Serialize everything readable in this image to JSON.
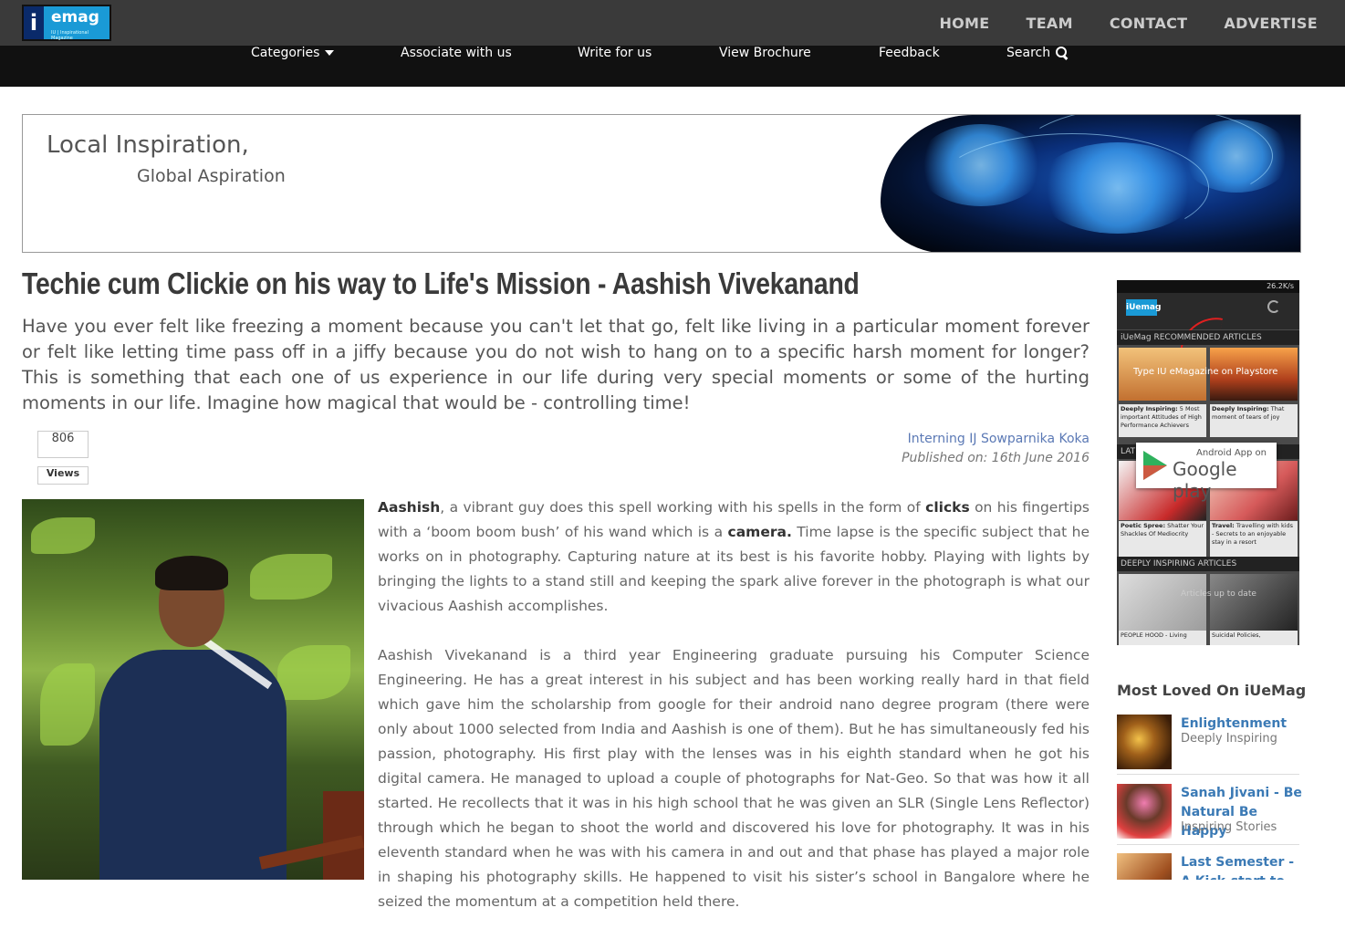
{
  "logo": {
    "letter": "i",
    "text": "emag",
    "subtext": "IU | Inspirational Magazine"
  },
  "topnav": [
    "HOME",
    "TEAM",
    "CONTACT",
    "ADVERTISE"
  ],
  "subnav": {
    "categories": "Categories",
    "associate": "Associate with us",
    "write": "Write for us",
    "brochure": "View Brochure",
    "feedback": "Feedback",
    "search": "Search"
  },
  "banner": {
    "line1": "Local Inspiration,",
    "line2": "Global Aspiration"
  },
  "article": {
    "title": "Techie cum Clickie on his way to Life's Mission - Aashish Vivekanand",
    "intro": "Have you ever felt like freezing a moment because you can't let that go, felt like living in a particular moment forever or felt like letting time pass off in a jiffy because you do not wish to hang on to a specific harsh moment for longer? This is something that each one of us experience in our life during very special moments or some of the hurting moments in our life. Imagine how magical that would be - controlling time!",
    "views_count": "806",
    "views_label": "Views",
    "author": "Interning IJ Sowparnika Koka",
    "published": "Published on: 16th June 2016",
    "p1_b1": "Aashish",
    "p1_t1": ", a vibrant guy does this spell working with his spells in the form of ",
    "p1_b2": "clicks",
    "p1_t2": " on his fingertips with a ‘boom boom bush’ of his wand which is a ",
    "p1_b3": "camera.",
    "p1_t3": " Time lapse is the specific subject that he works on in photography. Capturing nature at its best is his favorite hobby. Playing with lights by bringing the lights to a stand still and keeping the spark alive forever in the photograph is what our vivacious Aashish accomplishes.",
    "p2": "Aashish Vivekanand is a third year Engineering graduate pursuing his Computer Science Engineering. He has a great interest in his subject and has been working really hard in that field which gave him the scholarship from google for their android nano degree program (there were only about 1000 selected from India and Aashish is one of them). But he has simultaneously fed his passion, photography. His first play with the lenses was in his eighth standard when he got his digital camera. He managed to upload a couple of photographs for Nat-Geo. So that was how it all started. He recollects that it was in his high school that he was given an SLR (Single Lens Reflector) through which he began to shoot the world and discovered his love for photography. It was in his eleventh standard when he was with his camera in and out and that phase has played a major role in shaping his photography skills. He happened to visit his sister’s school in Bangalore where he seized the momentum at a competition held there."
  },
  "app_promo": {
    "status": "26.2K/s",
    "app_logo": "iUemag",
    "section1": "iUeMag RECOMMENDED ARTICLES",
    "tip": "Type IU eMagazine on Playstore",
    "cap1_b": "Deeply Inspiring:",
    "cap1": " 5 Most important Attitudes of High Performance Achievers",
    "cap2_b": "Deeply Inspiring:",
    "cap2": " That moment of tears of joy",
    "section2": "LAT",
    "gplay_small": "Android App on",
    "gplay_big": "Google play",
    "cap3_b": "Poetic Spree:",
    "cap3": " Shatter Your Shackles Of Mediocrity",
    "cap4_b": "Travel:",
    "cap4": " Travelling with kids - Secrets to an enjoyable stay in a resort",
    "section3": "DEEPLY INSPIRING ARTICLES",
    "overlay": "Articles up to date",
    "cap5": "PEOPLE HOOD - Living",
    "cap6": "Suicidal Policies,"
  },
  "most_loved": {
    "heading": "Most Loved On iUeMag",
    "items": [
      {
        "title": "Enlightenment",
        "category": "Deeply Inspiring"
      },
      {
        "title": "Sanah Jivani - Be Natural Be Happy",
        "category": "Inspiring Stories"
      },
      {
        "title": "Last Semester - A Kick-start to the",
        "category": ""
      }
    ]
  }
}
